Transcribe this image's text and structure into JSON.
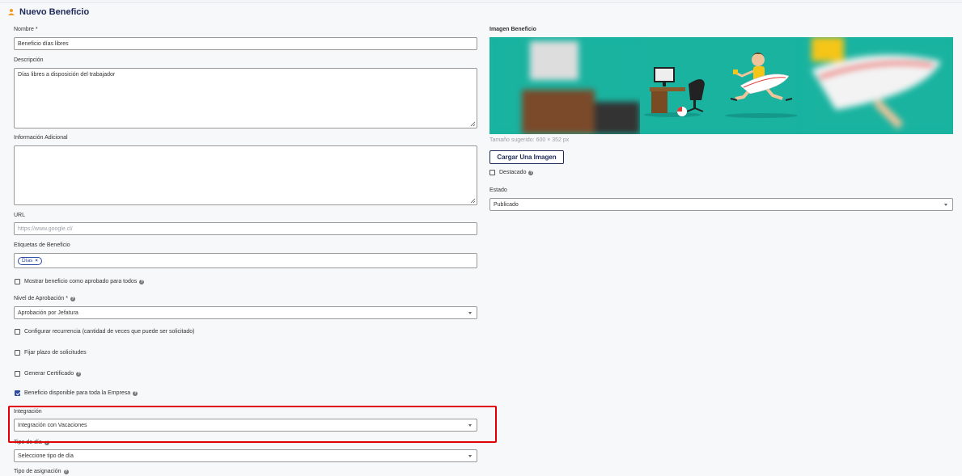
{
  "header": {
    "title": "Nuevo Beneficio",
    "icon": "user-icon"
  },
  "colors": {
    "brand": "#1e2a5a",
    "accent": "#2b4aa0",
    "highlight": "#e00000",
    "banner": "#19b3a0"
  },
  "form": {
    "nombre": {
      "label": "Nombre *",
      "value": "Beneficio días libres"
    },
    "descripcion": {
      "label": "Descripción",
      "value": "Días libres a disposición del trabajador"
    },
    "info_adicional": {
      "label": "Información Adicional",
      "value": ""
    },
    "url": {
      "label": "URL",
      "placeholder": "https://www.google.cl/"
    },
    "etiquetas": {
      "label": "Etiquetas de Beneficio",
      "tags": [
        "Días"
      ]
    },
    "mostrar_aprobado": {
      "label": "Mostrar beneficio como aprobado para todos",
      "checked": false
    },
    "nivel_aprobacion": {
      "label": "Nivel de Aprobación *",
      "value": "Aprobación por Jefatura"
    },
    "recurrencia": {
      "label": "Configurar recurrencia (cantidad de veces que puede ser solicitado)",
      "checked": false
    },
    "plazo": {
      "label": "Fijar plazo de solicitudes",
      "checked": false
    },
    "certificado": {
      "label": "Generar Certificado",
      "checked": false
    },
    "disponible_empresa": {
      "label": "Beneficio disponible para toda la Empresa",
      "checked": true
    },
    "integracion": {
      "label": "Integración",
      "value": "Integración con Vacaciones"
    },
    "tipo_dia": {
      "label": "Tipo de día",
      "value": "Seleccione tipo de día"
    },
    "tipo_asignacion": {
      "label": "Tipo de asignación"
    }
  },
  "side": {
    "imagen": {
      "label": "Imagen Beneficio",
      "hint": "Tamaño sugerido: 600 × 352 px",
      "upload_label": "Cargar Una Imagen"
    },
    "destacado": {
      "label": "Destacado",
      "checked": false
    },
    "estado": {
      "label": "Estado",
      "value": "Publicado"
    }
  },
  "help_glyph": "?",
  "tag_remove_glyph": "×"
}
